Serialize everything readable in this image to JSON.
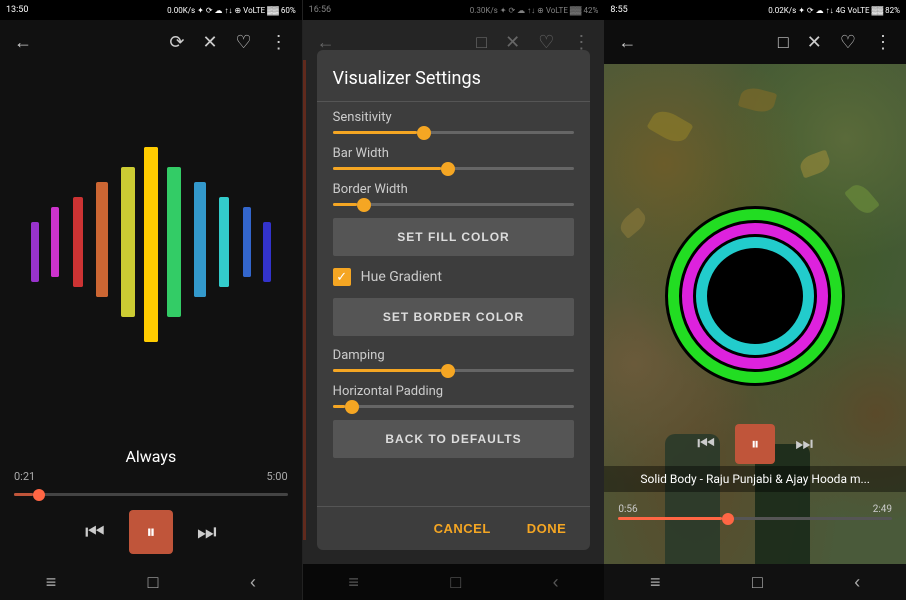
{
  "panel1": {
    "status_bar": {
      "time": "13:50",
      "right_icons": "0.00K/s ✦ ⟳ ☁ ↑↓ ⊕ VoLTE ▓▓ 60%"
    },
    "top_bar": {
      "back_icon": "←",
      "icons": [
        "⟳",
        "✕",
        "♡",
        "⋮"
      ]
    },
    "song_title": "Always",
    "time_current": "0:21",
    "time_total": "5:00",
    "progress_percent": 7,
    "controls": {
      "prev": "⏮",
      "play": "⏸",
      "next": "⏭"
    },
    "nav": [
      "≡",
      "□",
      "‹"
    ]
  },
  "panel2": {
    "status_bar": {
      "time": "16:56",
      "right_icons": "0.30K/s ✦ ⟳ ☁ ↑↓ ⊕ VoLTE ▓▓ 42%"
    },
    "top_bar": {
      "back_icon": "←",
      "icons": [
        "□",
        "✕",
        "♡",
        "⋮"
      ]
    },
    "settings": {
      "title": "Visualizer Settings",
      "sensitivity": {
        "label": "Sensitivity",
        "value": 35
      },
      "bar_width": {
        "label": "Bar Width",
        "value": 45
      },
      "border_width": {
        "label": "Border Width",
        "value": 10
      },
      "set_fill_color_btn": "SET FILL COLOR",
      "hue_gradient_label": "Hue Gradient",
      "set_border_color_btn": "SET BORDER COLOR",
      "damping": {
        "label": "Damping",
        "value": 45
      },
      "horizontal_padding": {
        "label": "Horizontal Padding",
        "value": 5
      },
      "back_to_defaults_btn": "BACK TO DEFAULTS",
      "cancel_btn": "CANCEL",
      "done_btn": "DONE"
    },
    "nav": [
      "≡",
      "□",
      "‹"
    ]
  },
  "panel3": {
    "status_bar": {
      "time": "8:55",
      "right_icons": "0.02K/s ✦ ⟳ ☁ ↑↓ 4G VoLTE ▓▓ 82%"
    },
    "top_bar": {
      "back_icon": "←",
      "icons": [
        "□",
        "✕",
        "♡",
        "⋮"
      ]
    },
    "song_info": "Solid Body - Raju Punjabi & Ajay Hooda m...",
    "time_current": "0:56",
    "time_total": "2:49",
    "progress_percent": 38,
    "controls": {
      "prev": "⏮",
      "play": "⏸",
      "next": "⏭"
    },
    "nav": [
      "≡",
      "□",
      "‹"
    ],
    "circles": [
      {
        "size": 180,
        "bg": "#22cc22",
        "border": "none"
      },
      {
        "size": 155,
        "bg": "#cc22cc",
        "border": "none"
      },
      {
        "size": 130,
        "bg": "#22cccc",
        "border": "none"
      },
      {
        "size": 105,
        "bg": "#000",
        "border": "none"
      }
    ]
  },
  "visualizer_bars": [
    {
      "height": 60,
      "color": "#cc3333"
    },
    {
      "height": 90,
      "color": "#cc6633"
    },
    {
      "height": 110,
      "color": "#cccc33"
    },
    {
      "height": 140,
      "color": "#ffcc00"
    },
    {
      "height": 170,
      "color": "#ffcc00"
    },
    {
      "height": 140,
      "color": "#33cc33"
    },
    {
      "height": 110,
      "color": "#3333cc"
    },
    {
      "height": 80,
      "color": "#6633cc"
    },
    {
      "height": 50,
      "color": "#cc33cc"
    }
  ]
}
